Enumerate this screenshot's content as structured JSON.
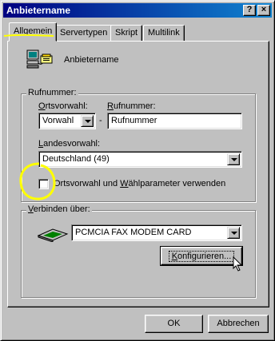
{
  "window": {
    "title": "Anbietername"
  },
  "titlebar": {
    "help_label": "?",
    "close_label": "×"
  },
  "tabs": [
    {
      "label": "Allgemein",
      "active": true
    },
    {
      "label": "Servertypen",
      "active": false
    },
    {
      "label": "Skript",
      "active": false
    },
    {
      "label": "Multilink",
      "active": false
    }
  ],
  "connection": {
    "name": "Anbietername"
  },
  "phone": {
    "group_label": "Rufnummer:",
    "area_code_label_prefix": "",
    "area_code_label_u": "O",
    "area_code_label_rest": "rtsvorwahl:",
    "area_code_value": "Vorwahl",
    "separator": "-",
    "number_label_u": "R",
    "number_label_rest": "ufnummer:",
    "number_value": "Rufnummer",
    "country_label_u": "L",
    "country_label_rest": "andesvorwahl:",
    "country_value": "Deutschland (49)",
    "checkbox_text_1": "Orts",
    "checkbox_text_2": "vorwahl und ",
    "checkbox_text_u": "W",
    "checkbox_text_3": "ählparameter verwenden",
    "checkbox_checked": false
  },
  "connect": {
    "group_label_u": "V",
    "group_label_rest": "erbinden über:",
    "modem_value": "PCMCIA FAX MODEM CARD",
    "configure_label_u": "K",
    "configure_label_rest": "onfigurieren..."
  },
  "footer": {
    "ok_label": "OK",
    "cancel_label": "Abbrechen"
  },
  "annotation": {
    "color": "#ffff00"
  }
}
